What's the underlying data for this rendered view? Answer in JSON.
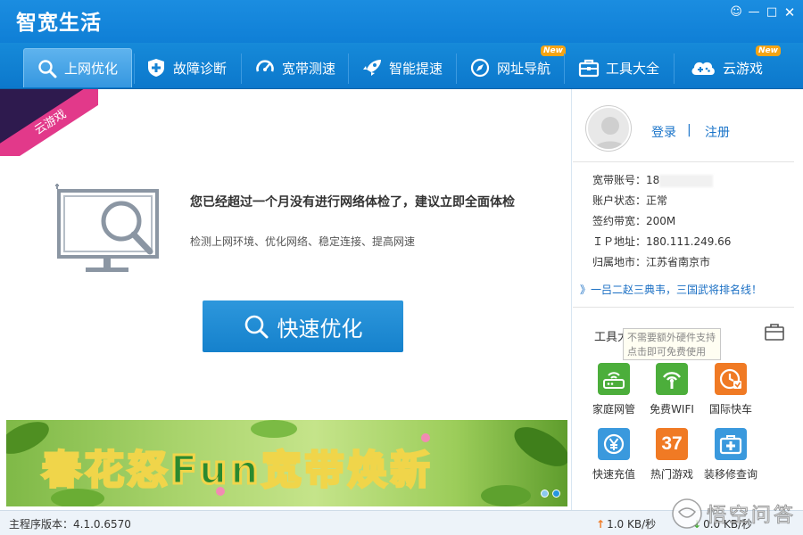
{
  "app": {
    "title": "智宽生活"
  },
  "window_controls": {
    "feedback": "☺",
    "minimize": "—",
    "maximize": "□",
    "close": "✕"
  },
  "nav": {
    "items": [
      {
        "label": "上网优化",
        "icon": "search-icon",
        "active": true
      },
      {
        "label": "故障诊断",
        "icon": "shield-plus-icon",
        "active": false
      },
      {
        "label": "宽带测速",
        "icon": "speedometer-icon",
        "active": false
      },
      {
        "label": "智能提速",
        "icon": "rocket-icon",
        "active": false
      },
      {
        "label": "网址导航",
        "icon": "compass-icon",
        "active": false,
        "badge": "New"
      },
      {
        "label": "工具大全",
        "icon": "toolbox-icon",
        "active": false
      },
      {
        "label": "云游戏",
        "icon": "cloud-game-icon",
        "active": false,
        "badge": "New"
      }
    ]
  },
  "main": {
    "ribbon": "云游戏",
    "notice_title": "您已经超过一个月没有进行网络体检了，建议立即全面体检",
    "notice_sub": "检测上网环境、优化网络、稳定连接、提高网速",
    "quick_button": "快速优化",
    "banner_text": "春花怒Fun宽带焕新"
  },
  "side": {
    "login": "登录",
    "separator": "|",
    "register": "注册",
    "info": [
      {
        "label": "宽带账号：",
        "value": "18"
      },
      {
        "label": "账户状态：",
        "value": "正常"
      },
      {
        "label": "签约带宽：",
        "value": "200M"
      },
      {
        "label": "ＩＰ地址：",
        "value": "180.111.249.66"
      },
      {
        "label": "归属地市：",
        "value": "江苏省南京市"
      }
    ],
    "promo": "》一吕二赵三典韦，三国武将排名线！",
    "tools_title": "工具大全",
    "tooltip_line1": "不需要额外硬件支持",
    "tooltip_line2": "点击即可免费使用",
    "tools": [
      {
        "label": "家庭网管",
        "icon": "router-icon",
        "color": "#4cae3b"
      },
      {
        "label": "免费WIFI",
        "icon": "wifi-icon",
        "color": "#4cae3b"
      },
      {
        "label": "国际快车",
        "icon": "globe-clock-icon",
        "color": "#f07a24"
      },
      {
        "label": "快速充值",
        "icon": "yen-coin-icon",
        "color": "#3a99dd"
      },
      {
        "label": "热门游戏",
        "icon": "game-37-icon",
        "color": "#f07a24",
        "glyph": "37"
      },
      {
        "label": "装移修查询",
        "icon": "medical-kit-icon",
        "color": "#3a99dd"
      }
    ]
  },
  "status": {
    "version": "主程序版本：4.1.0.6570",
    "upload": "1.0 KB/秒",
    "download": "0.0 KB/秒",
    "upload_arrow": "↑",
    "download_arrow": "↓"
  },
  "watermark": "悟空问答"
}
